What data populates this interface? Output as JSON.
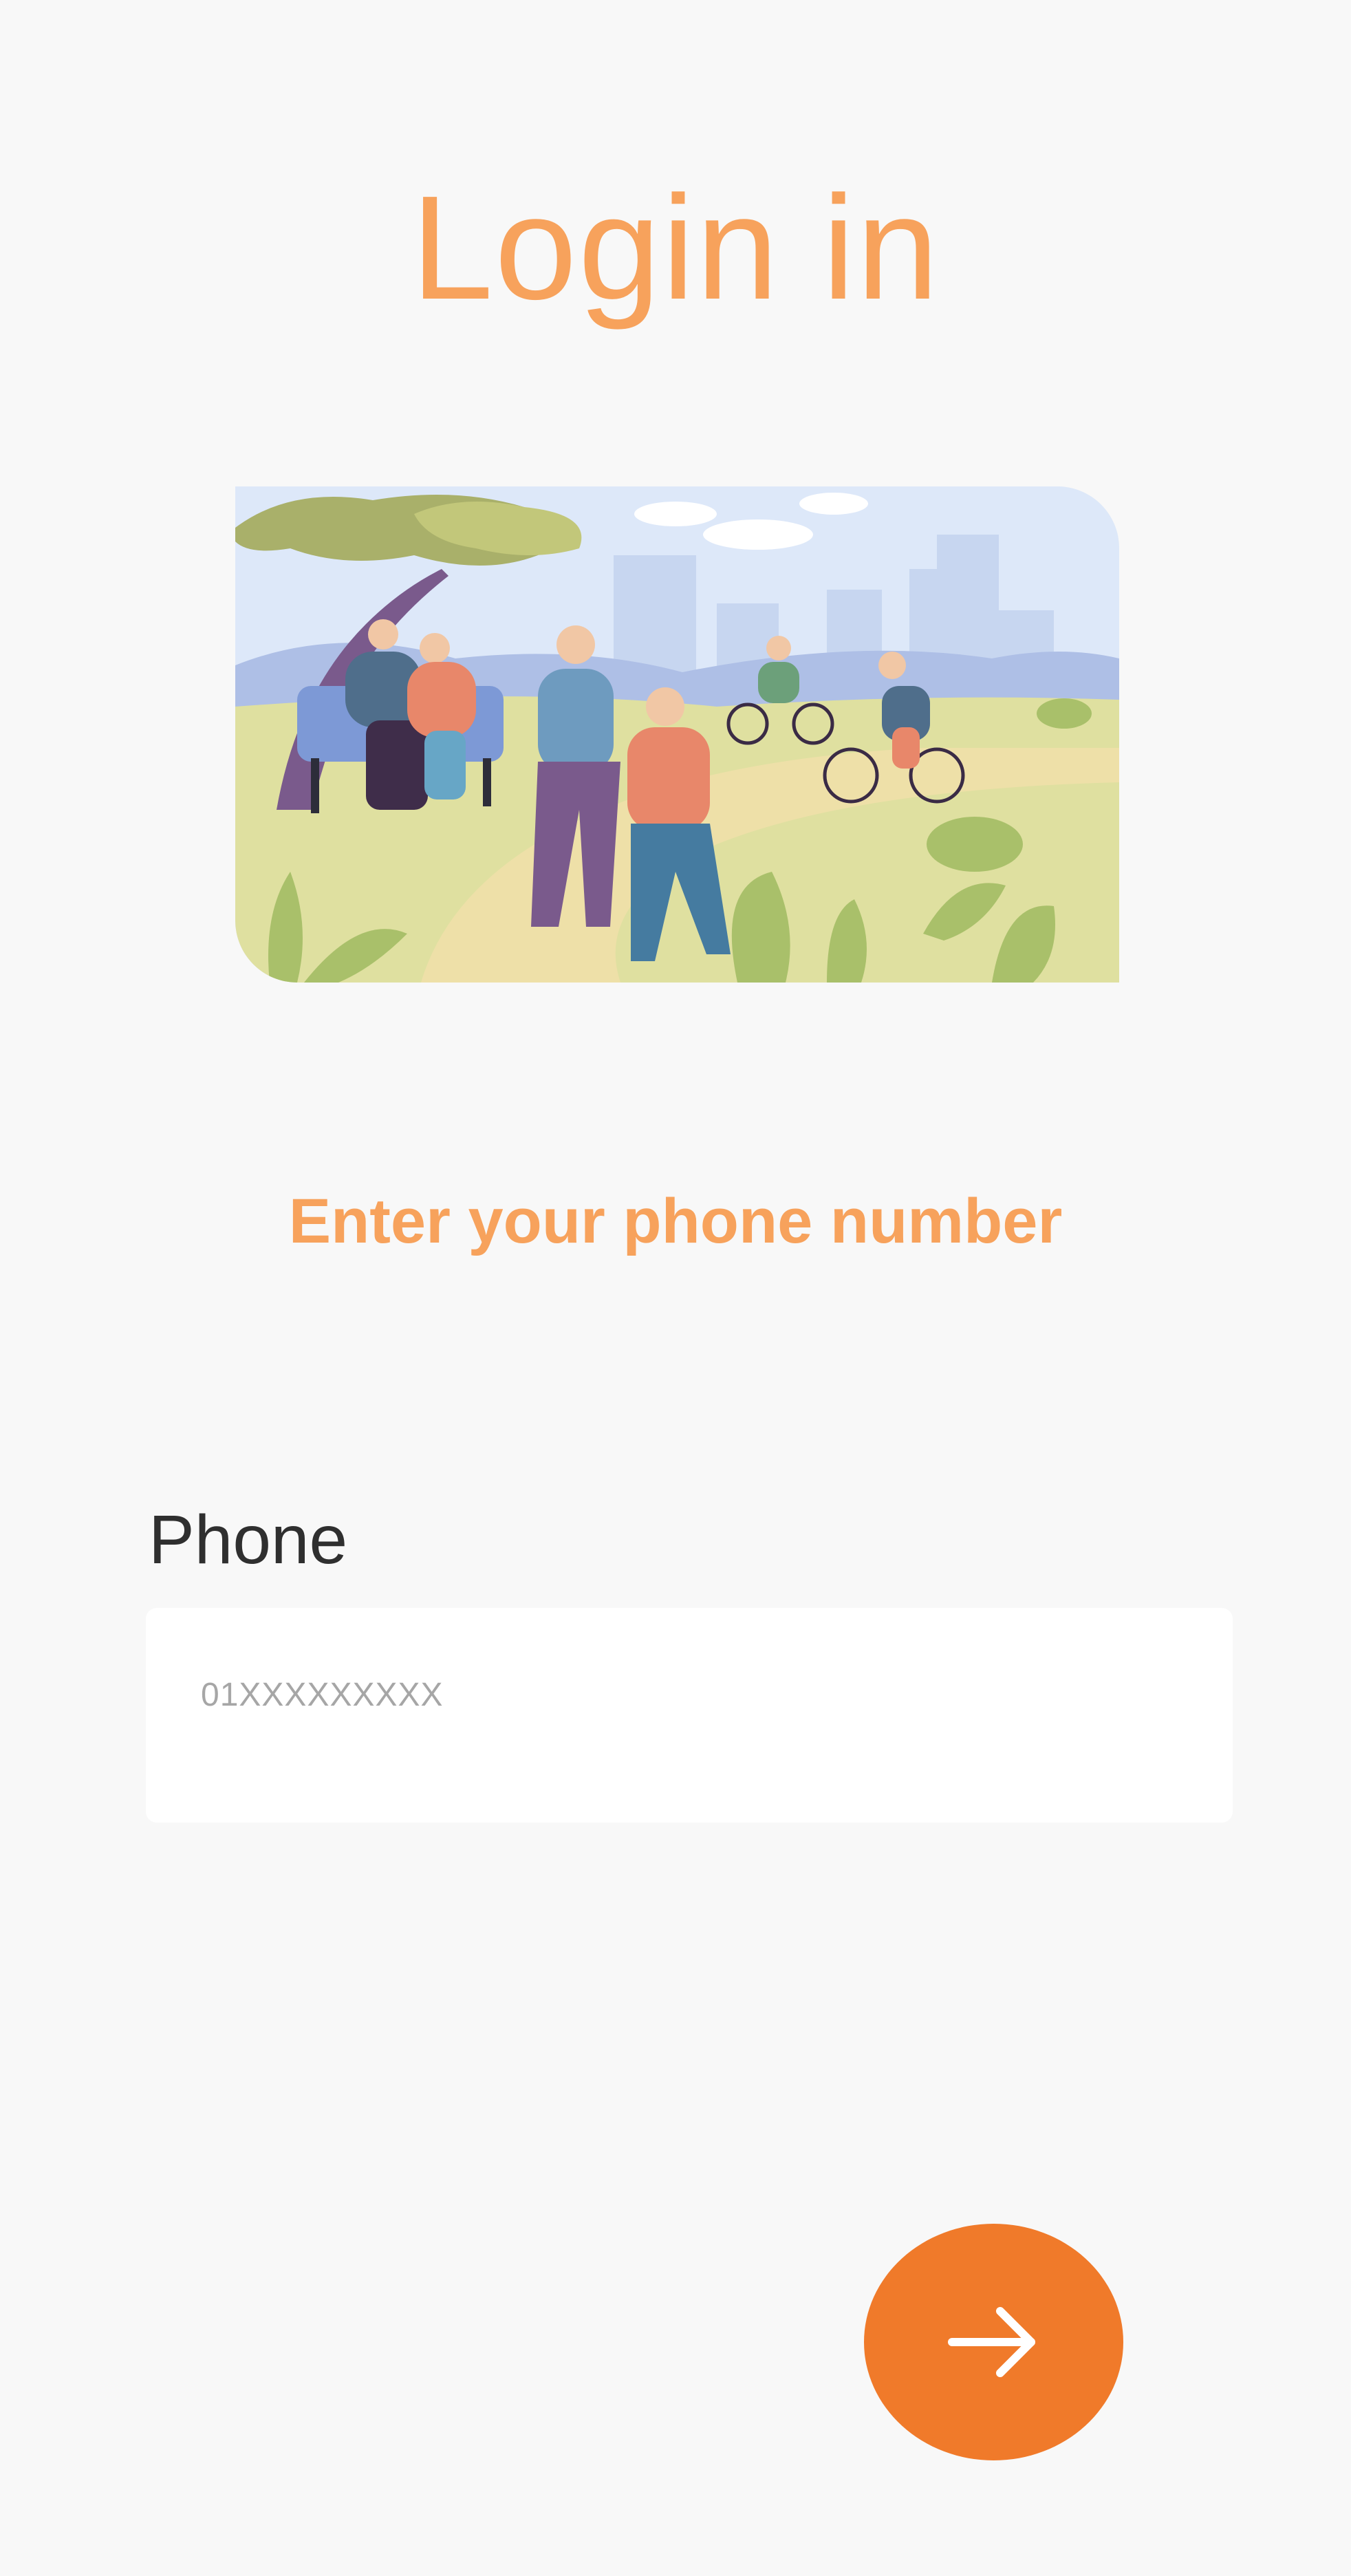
{
  "title": "Login in",
  "hero": {
    "alt": "Elderly people exercising in a park"
  },
  "subtitle": "Enter your phone number",
  "phone": {
    "label": "Phone",
    "placeholder": "01XXXXXXXXX",
    "value": ""
  },
  "next_button": {
    "icon": "arrow-right-icon"
  },
  "colors": {
    "accent": "#f7a25c",
    "button": "#f07a2a",
    "background": "#f8f8f8",
    "label": "#2f2f2f"
  }
}
